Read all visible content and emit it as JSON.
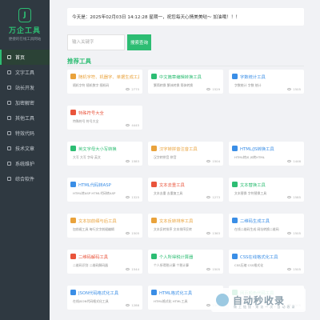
{
  "sidebar": {
    "logo_title": "万企工具",
    "logo_sub": "便捷的在线工具网站",
    "items": [
      {
        "label": "首页",
        "active": true
      },
      {
        "label": "文字工具"
      },
      {
        "label": "站长开发"
      },
      {
        "label": "加密解密"
      },
      {
        "label": "其他工具"
      },
      {
        "label": "特效代码"
      },
      {
        "label": "技术文章"
      },
      {
        "label": "系统维护"
      },
      {
        "label": "综合软件"
      }
    ]
  },
  "notice": "今天是：2025年02月03日  14:12:28  星期一，祝您每天心情美美哒～ 加油哦！！！",
  "search": {
    "placeholder": "输入关键字",
    "button": "搜索查询"
  },
  "section_title": "推荐工具",
  "cards": [
    {
      "title": "随机字符、机器字、单据生成工具",
      "desc": "随机字符  随机数字  随机码",
      "views": "2775",
      "color": "#e9a23b"
    },
    {
      "title": "中文篇章编辑转换工具",
      "desc": "繁简转换  繁体转换  简体转换",
      "views": "1529",
      "color": "#2dbd73"
    },
    {
      "title": "字数统计工具",
      "desc": "字数统计  字数  统计",
      "views": "1505",
      "color": "#3a8ee6"
    },
    {
      "title": "特殊符号大全",
      "desc": "特殊符号  符号大全",
      "views": "4445",
      "color": "#e9543b"
    },
    {
      "title": "",
      "desc": "",
      "views": "",
      "color": "#f1f2f5"
    },
    {
      "title": "",
      "desc": "",
      "views": "",
      "color": "#f1f2f5"
    },
    {
      "title": "英文字母大小写转换",
      "desc": "大写  大写  字母  英文",
      "views": "1583",
      "color": "#2dbd73"
    },
    {
      "title": "汉字转拼音注音工具",
      "desc": "汉字转拼音  拼音",
      "views": "1504",
      "color": "#e9a23b"
    },
    {
      "title": "HTML/JS转换工具",
      "desc": "HTML转JS  JS转HTML",
      "views": "1446",
      "color": "#3a8ee6"
    },
    {
      "title": "HTML代码转ASP",
      "desc": "HTML转ASP  HTML代码转ASP",
      "views": "1325",
      "color": "#3a8ee6"
    },
    {
      "title": "文本去重工具",
      "desc": "文本去重  去重复工具",
      "views": "1273",
      "color": "#e9543b"
    },
    {
      "title": "文本替换工具",
      "desc": "文本替换  字符替换工具",
      "views": "1585",
      "color": "#2dbd73"
    },
    {
      "title": "文本加前缀与后工具",
      "desc": "加前缀工具  每行文字前缀编辑",
      "views": "1505",
      "color": "#e9a23b"
    },
    {
      "title": "文本反转排序工具",
      "desc": "文本反转排序  文本排序反转",
      "views": "1363",
      "color": "#e9a23b"
    },
    {
      "title": "二维码生成工具",
      "desc": "在线二维码生成  网址转换二维码",
      "views": "1505",
      "color": "#3a8ee6"
    },
    {
      "title": "二维码解码工具",
      "desc": "二维码识别  二维码解码器",
      "views": "1544",
      "color": "#e9543b"
    },
    {
      "title": "个人所得税计算器",
      "desc": "个人所得税计算  个税计算",
      "views": "1505",
      "color": "#2dbd73"
    },
    {
      "title": "CSS在线格式化工具",
      "desc": "CSS压缩  CSS格式化",
      "views": "1505",
      "color": "#3a8ee6"
    },
    {
      "title": "JSON代码格式化工具",
      "desc": "在线JSON代码格式化工具",
      "views": "1286",
      "color": "#3a8ee6"
    },
    {
      "title": "HTML格式化工具",
      "desc": "HTML格式化  HTML工具",
      "views": "1505",
      "color": "#3a8ee6"
    },
    {
      "title": "网页颜色代码工具",
      "desc": "颜色代码  网页颜色",
      "views": "1505",
      "color": "#2dbd73"
    }
  ],
  "watermark": {
    "text": "自动秒收录",
    "sub": "做上链接·来访一次·自动收录"
  }
}
